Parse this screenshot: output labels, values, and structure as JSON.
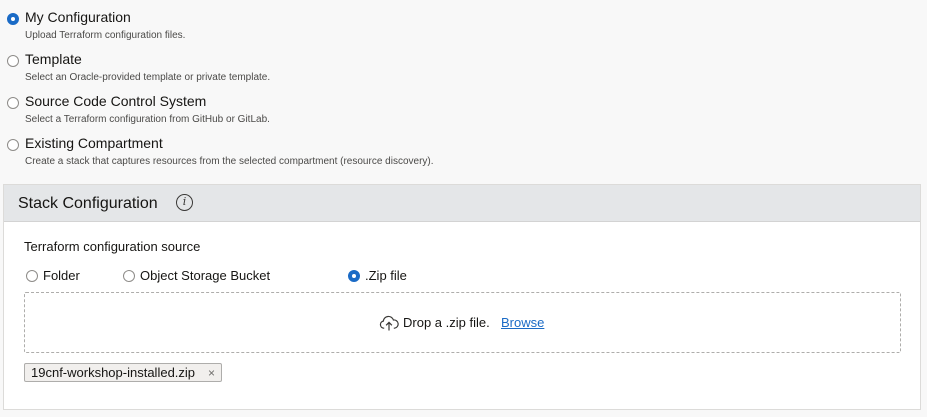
{
  "origin_options": [
    {
      "label": "My Configuration",
      "description": "Upload Terraform configuration files.",
      "selected": true
    },
    {
      "label": "Template",
      "description": "Select an Oracle-provided template or private template.",
      "selected": false
    },
    {
      "label": "Source Code Control System",
      "description": "Select a Terraform configuration from GitHub or GitLab.",
      "selected": false
    },
    {
      "label": "Existing Compartment",
      "description": "Create a stack that captures resources from the selected compartment (resource discovery).",
      "selected": false
    }
  ],
  "stack_configuration": {
    "title": "Stack Configuration",
    "info_icon": "i",
    "source_label": "Terraform configuration source",
    "source_options": [
      {
        "label": "Folder",
        "selected": false
      },
      {
        "label": "Object Storage Bucket",
        "selected": false
      },
      {
        "label": ".Zip file",
        "selected": true
      }
    ],
    "dropzone": {
      "icon": "cloud-upload-icon",
      "text": "Drop a .zip file.",
      "browse_label": "Browse"
    },
    "uploaded_file": {
      "name": "19cnf-workshop-installed.zip",
      "remove_glyph": "×"
    }
  },
  "colors": {
    "accent": "#1b6bc6",
    "header_bg": "#e4e6e8",
    "page_bg": "#f8f8f8"
  }
}
